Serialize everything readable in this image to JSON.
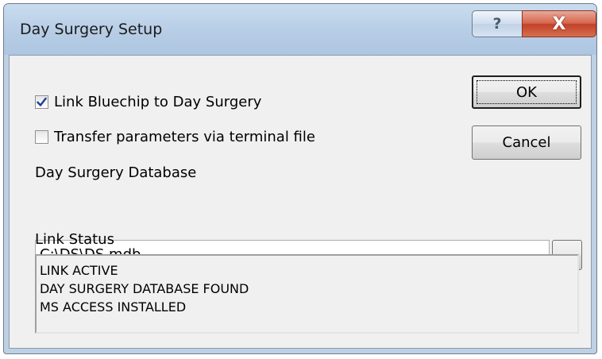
{
  "window": {
    "title": "Day Surgery Setup",
    "help_glyph": "?",
    "close_glyph": "X"
  },
  "options": {
    "link_checkbox": {
      "label": "Link Bluechip to Day Surgery",
      "checked": true
    },
    "transfer_checkbox": {
      "label": "Transfer parameters via terminal file",
      "checked": false
    }
  },
  "buttons": {
    "ok": "OK",
    "cancel": "Cancel",
    "browse": "..."
  },
  "database": {
    "label": "Day Surgery Database",
    "path": "C:\\DS\\DS.mdb"
  },
  "status": {
    "label": "Link Status",
    "lines": [
      "LINK ACTIVE",
      "DAY SURGERY DATABASE FOUND",
      "MS ACCESS INSTALLED"
    ]
  },
  "colors": {
    "titlebar": "#b9cfe6",
    "close_button": "#c9472e",
    "dialog_face": "#f0f0f0",
    "checkmark": "#1c3f94"
  },
  "icons": {
    "checkmark": "check-icon",
    "help": "help-icon",
    "close": "close-icon"
  }
}
